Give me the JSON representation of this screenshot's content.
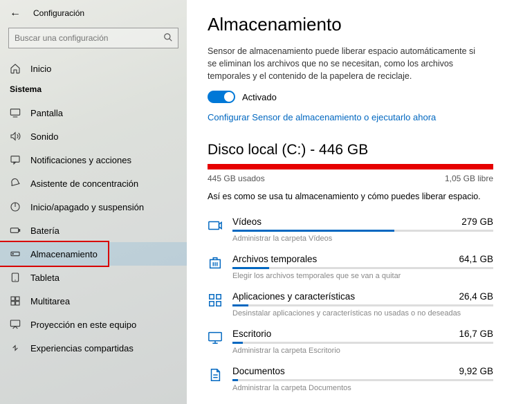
{
  "header": {
    "title": "Configuración"
  },
  "search": {
    "placeholder": "Buscar una configuración"
  },
  "sidebar": {
    "home_label": "Inicio",
    "section_label": "Sistema",
    "items": [
      {
        "label": "Pantalla"
      },
      {
        "label": "Sonido"
      },
      {
        "label": "Notificaciones y acciones"
      },
      {
        "label": "Asistente de concentración"
      },
      {
        "label": "Inicio/apagado y suspensión"
      },
      {
        "label": "Batería"
      },
      {
        "label": "Almacenamiento"
      },
      {
        "label": "Tableta"
      },
      {
        "label": "Multitarea"
      },
      {
        "label": "Proyección en este equipo"
      },
      {
        "label": "Experiencias compartidas"
      }
    ]
  },
  "main": {
    "title": "Almacenamiento",
    "description": "Sensor de almacenamiento puede liberar espacio automáticamente si se eliminan los archivos que no se necesitan, como los archivos temporales y el contenido de la papelera de reciclaje.",
    "toggle_label": "Activado",
    "config_link": "Configurar Sensor de almacenamiento o ejecutarlo ahora",
    "disk": {
      "title": "Disco local (C:) - 446 GB",
      "used_label": "445 GB usados",
      "free_label": "1,05 GB libre",
      "usage_pct": 99.8,
      "intro": "Así es como se usa tu almacenamiento y cómo puedes liberar espacio."
    },
    "categories": [
      {
        "name": "Vídeos",
        "size": "279 GB",
        "pct": 62,
        "sub": "Administrar la carpeta Vídeos"
      },
      {
        "name": "Archivos temporales",
        "size": "64,1 GB",
        "pct": 14,
        "sub": "Elegir los archivos temporales que se van a quitar"
      },
      {
        "name": "Aplicaciones y características",
        "size": "26,4 GB",
        "pct": 6,
        "sub": "Desinstalar aplicaciones y características no usadas o no deseadas"
      },
      {
        "name": "Escritorio",
        "size": "16,7 GB",
        "pct": 4,
        "sub": "Administrar la carpeta Escritorio"
      },
      {
        "name": "Documentos",
        "size": "9,92 GB",
        "pct": 2,
        "sub": "Administrar la carpeta Documentos"
      }
    ]
  }
}
